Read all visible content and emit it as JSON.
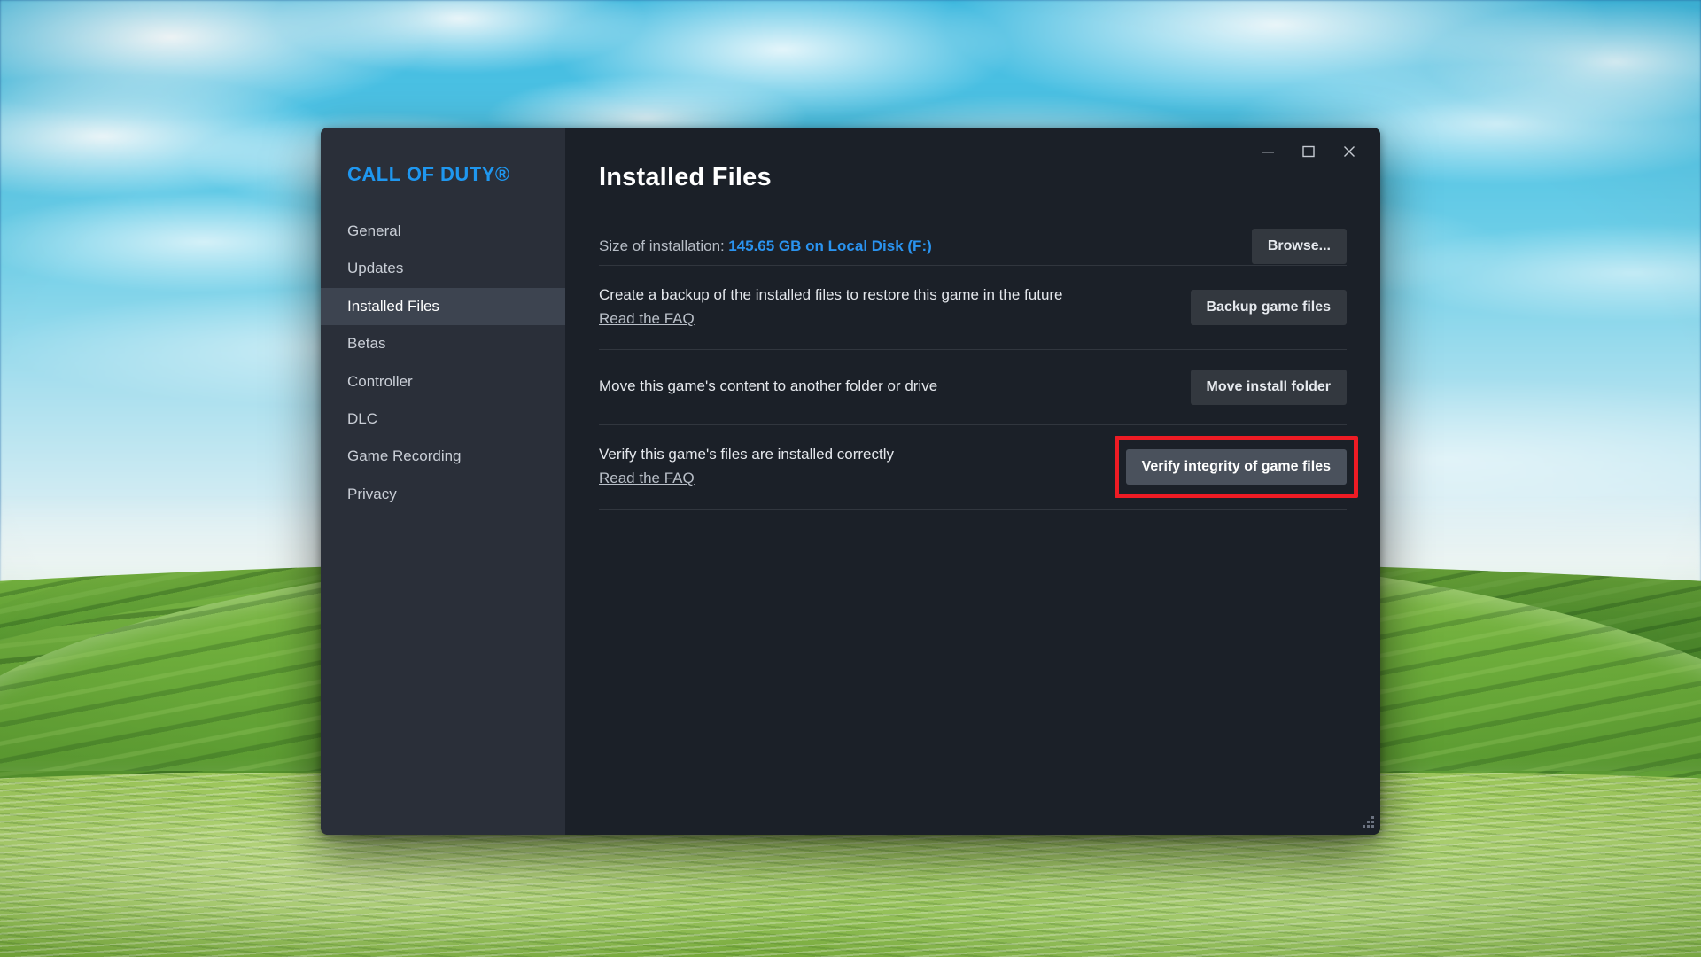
{
  "desktop": {
    "wallpaper_name": "rolling-green-hills-blue-sky"
  },
  "window": {
    "game_title": "CALL OF DUTY®",
    "page_title": "Installed Files",
    "controls": {
      "minimize": "minimize-button",
      "maximize": "maximize-button",
      "close": "close-button"
    }
  },
  "sidebar": {
    "items": [
      {
        "label": "General",
        "active": false
      },
      {
        "label": "Updates",
        "active": false
      },
      {
        "label": "Installed Files",
        "active": true
      },
      {
        "label": "Betas",
        "active": false
      },
      {
        "label": "Controller",
        "active": false
      },
      {
        "label": "DLC",
        "active": false
      },
      {
        "label": "Game Recording",
        "active": false
      },
      {
        "label": "Privacy",
        "active": false
      }
    ]
  },
  "main": {
    "size_row": {
      "label": "Size of installation:",
      "value": "145.65 GB on Local Disk (F:)",
      "button": "Browse..."
    },
    "rows": [
      {
        "text": "Create a backup of the installed files to restore this game in the future",
        "link": "Read the FAQ",
        "button": "Backup game files",
        "has_link": true,
        "highlighted": false
      },
      {
        "text": "Move this game's content to another folder or drive",
        "link": "",
        "button": "Move install folder",
        "has_link": false,
        "highlighted": false
      },
      {
        "text": "Verify this game's files are installed correctly",
        "link": "Read the FAQ",
        "button": "Verify integrity of game files",
        "has_link": true,
        "highlighted": true
      }
    ]
  },
  "colors": {
    "accent_blue": "#2a93ef",
    "brand_blue": "#1f97ef",
    "highlight_red": "#ee1b24",
    "window_bg": "#1b2028",
    "sidebar_bg": "#2a2f39",
    "nav_active_bg": "#3d4450",
    "button_bg": "#33383f",
    "button_hover_bg": "#4a515c"
  }
}
